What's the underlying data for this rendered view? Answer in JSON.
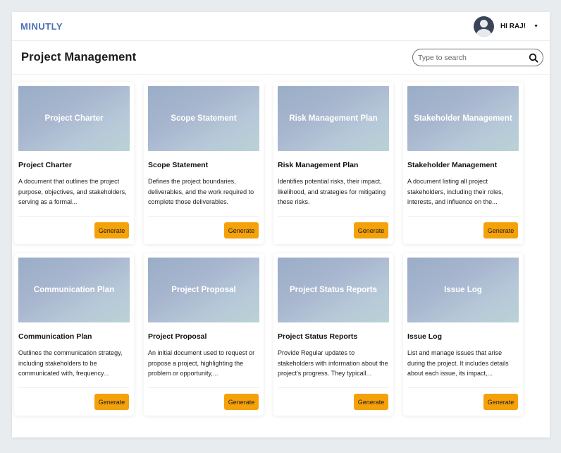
{
  "app": {
    "logo": "MINUTLY"
  },
  "user": {
    "greeting": "HI RAJ!"
  },
  "page": {
    "title": "Project Management"
  },
  "search": {
    "placeholder": "Type to search"
  },
  "colors": {
    "accent": "#f5a20a",
    "brand": "#4b6fb5"
  },
  "cards": [
    {
      "thumb": "Project Charter",
      "title": "Project Charter",
      "desc": "A document that outlines the project purpose, objectives, and stakeholders, serving as a formal...",
      "button": "Generate"
    },
    {
      "thumb": "Scope Statement",
      "title": "Scope Statement",
      "desc": "Defines the project boundaries, deliverables, and the work required to complete those deliverables.",
      "button": "Generate"
    },
    {
      "thumb": "Risk Management Plan",
      "title": "Risk Management Plan",
      "desc": "Identifies potential risks, their impact, likelihood, and strategies for mitigating these risks.",
      "button": "Generate"
    },
    {
      "thumb": "Stakeholder Management",
      "title": "Stakeholder Management",
      "desc": "A document listing all project stakeholders, including their roles, interests, and influence on the...",
      "button": "Generate"
    },
    {
      "thumb": "Communication Plan",
      "title": "Communication Plan",
      "desc": "Outlines the communication strategy, including stakeholders to be communicated with, frequency...",
      "button": "Generate"
    },
    {
      "thumb": "Project Proposal",
      "title": "Project Proposal",
      "desc": "An initial document used to request or propose a project, highlighting the problem or opportunity,...",
      "button": "Generate"
    },
    {
      "thumb": "Project Status Reports",
      "title": "Project Status Reports",
      "desc": "Provide Regular updates to stakeholders with information about the project's progress. They typicall...",
      "button": "Generate"
    },
    {
      "thumb": "Issue Log",
      "title": "Issue Log",
      "desc": "List and manage issues that arise during the project. It includes details about each issue, its impact,...",
      "button": "Generate"
    }
  ]
}
